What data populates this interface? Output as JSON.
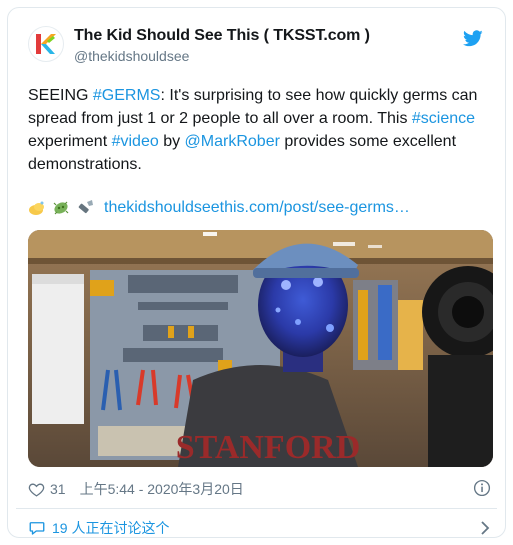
{
  "account": {
    "display_name": "The Kid Should See This ( TKSST.com )",
    "handle": "@thekidshouldsee",
    "avatar_icon": "tkst-logo-icon",
    "platform_icon": "twitter-bird-icon"
  },
  "tweet": {
    "text_1": "SEEING ",
    "hashtag_germs": "#GERMS",
    "text_2": ": It's surprising to see how quickly germs can spread from just 1 or 2 people to all over a room. This ",
    "hashtag_science": "#science",
    "text_3": " experiment ",
    "hashtag_video": "#video",
    "text_4": " by ",
    "mention": "@MarkRober",
    "text_5": " provides some excellent demonstrations.",
    "link_emojis": [
      "hand-wash-icon",
      "microbe-icon",
      "flashlight-icon"
    ],
    "link_url": "thekidshouldseethis.com/post/see-germs…"
  },
  "media": {
    "shirt_text": "STANFORD",
    "description_icon": "video-thumbnail"
  },
  "meta": {
    "like_count": "31",
    "timestamp": "上午5:44 - 2020年3月20日"
  },
  "footer": {
    "discussion_text": "19 人正在讨论这个"
  },
  "colors": {
    "link": "#1b95e0",
    "secondary_text": "#657786",
    "border": "#e1e8ed"
  }
}
